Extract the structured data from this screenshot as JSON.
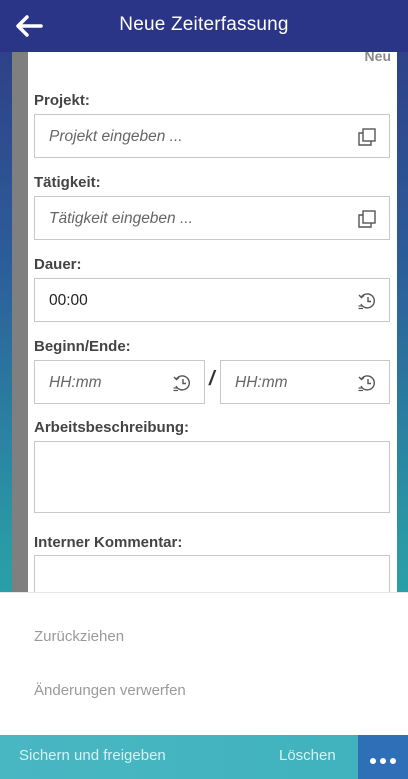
{
  "header": {
    "title": "Neue Zeiterfassung",
    "back_icon": "arrow-left-icon"
  },
  "form": {
    "status": "Neu",
    "projekt": {
      "label": "Projekt:",
      "placeholder": "Projekt eingeben ...",
      "icon": "copy-icon"
    },
    "taetigkeit": {
      "label": "Tätigkeit:",
      "placeholder": "Tätigkeit eingeben ...",
      "icon": "copy-icon"
    },
    "dauer": {
      "label": "Dauer:",
      "value": "00:00",
      "icon": "clock-history-icon"
    },
    "beginn_ende": {
      "label": "Beginn/Ende:",
      "beginn_placeholder": "HH:mm",
      "separator": "/",
      "ende_placeholder": "HH:mm",
      "icon": "clock-history-icon"
    },
    "arbeitsbeschreibung": {
      "label": "Arbeitsbeschreibung:",
      "value": ""
    },
    "interner_kommentar": {
      "label": "Interner Kommentar:",
      "value": ""
    }
  },
  "sheet": {
    "items": [
      {
        "label": "Zurückziehen"
      },
      {
        "label": "Änderungen verwerfen"
      }
    ]
  },
  "bottom_bar": {
    "primary": "Sichern und freigeben",
    "delete": "Löschen",
    "more_icon": "more-dots-icon"
  },
  "colors": {
    "header_bg": "#2b3587",
    "bottom_bar_bg": "#49b7c2",
    "more_button_bg": "#2f6fb8"
  }
}
